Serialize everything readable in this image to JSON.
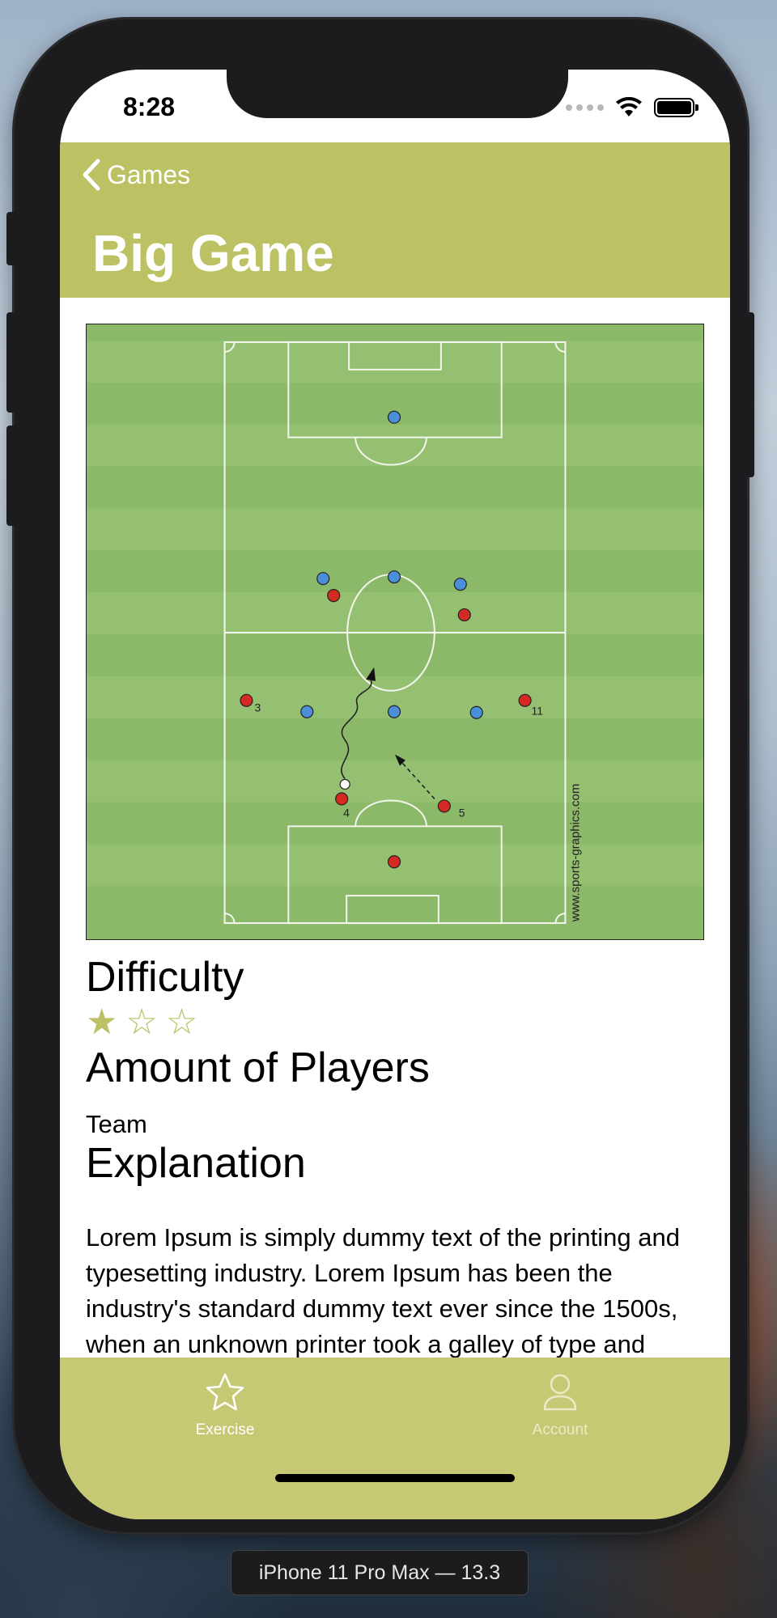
{
  "status_bar": {
    "time": "8:28"
  },
  "nav": {
    "back_label": "Games",
    "title": "Big Game"
  },
  "diagram": {
    "watermark": "www.sports-graphics.com",
    "labels": [
      "3",
      "11",
      "4",
      "5"
    ]
  },
  "difficulty": {
    "heading": "Difficulty",
    "rating": 1,
    "max": 3,
    "star_color": "#bcc263"
  },
  "players": {
    "heading": "Amount of Players",
    "value": "Team"
  },
  "explanation": {
    "heading": "Explanation",
    "text": "Lorem Ipsum is simply dummy text of the printing and typesetting industry. Lorem Ipsum has been the industry's standard dummy text ever since the 1500s, when an unknown printer took a galley of type and scrambled it to make a type specimen book. It has survived not only five centuries, but"
  },
  "tabbar": {
    "tabs": [
      {
        "label": "Exercise",
        "icon": "star-icon",
        "selected": true
      },
      {
        "label": "Account",
        "icon": "person-icon",
        "selected": false
      }
    ]
  },
  "simulator": {
    "label": "iPhone 11 Pro Max — 13.3"
  },
  "colors": {
    "accent": "#bcc263",
    "tabbar": "#c6c974"
  }
}
